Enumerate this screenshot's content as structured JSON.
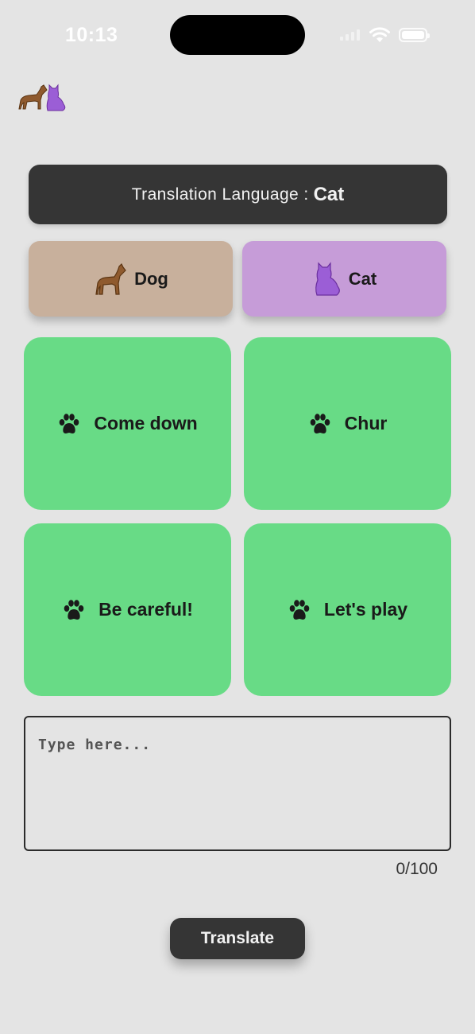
{
  "status_bar": {
    "time": "10:13"
  },
  "language_banner": {
    "label": "Translation Language :",
    "value": "Cat"
  },
  "animals": [
    {
      "label": "Dog",
      "icon": "dog-icon",
      "color": "#c8b09c"
    },
    {
      "label": "Cat",
      "icon": "cat-icon",
      "color": "#c69cd8"
    }
  ],
  "phrases": [
    {
      "label": "Come down",
      "icon": "paw-icon"
    },
    {
      "label": "Chur",
      "icon": "paw-icon"
    },
    {
      "label": "Be careful!",
      "icon": "paw-icon"
    },
    {
      "label": "Let's play",
      "icon": "paw-icon"
    }
  ],
  "input": {
    "placeholder": "Type here...",
    "value": "",
    "counter": "0/100"
  },
  "translate_button": {
    "label": "Translate"
  },
  "colors": {
    "background": "#e4e4e4",
    "dark": "#353535",
    "card_green": "#68db86",
    "dog_brown": "#c8b09c",
    "cat_purple": "#c69cd8"
  }
}
